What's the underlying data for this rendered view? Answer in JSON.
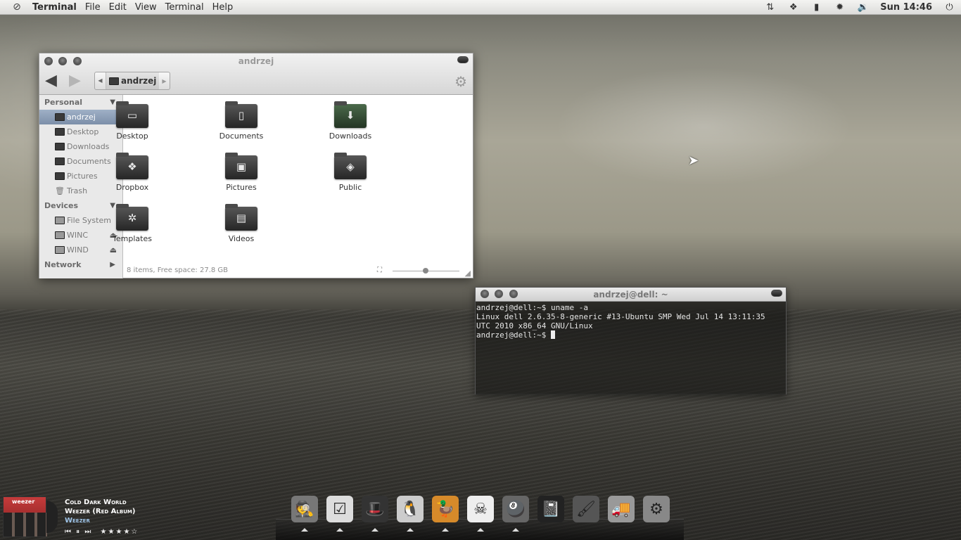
{
  "topbar": {
    "app_name": "Terminal",
    "menus": [
      "File",
      "Edit",
      "View",
      "Terminal",
      "Help"
    ],
    "tray_icons": [
      "network-icon",
      "dropbox-icon",
      "battery-icon",
      "weather-icon",
      "volume-icon"
    ],
    "clock": "Sun 14:46"
  },
  "file_manager": {
    "title": "andrzej",
    "breadcrumb": "andrzej",
    "sidebar": {
      "personal_label": "Personal",
      "personal_items": [
        "andrzej",
        "Desktop",
        "Downloads",
        "Documents",
        "Pictures",
        "Trash"
      ],
      "devices_label": "Devices",
      "device_items": [
        "File System",
        "WINC",
        "WIND"
      ],
      "network_label": "Network"
    },
    "files": [
      "Desktop",
      "Documents",
      "Downloads",
      "Dropbox",
      "Pictures",
      "Public",
      "Templates",
      "Videos"
    ],
    "status": "8 items, Free space: 27.8 GB"
  },
  "terminal": {
    "title": "andrzej@dell: ~",
    "lines": [
      "andrzej@dell:~$ uname -a",
      "Linux dell 2.6.35-8-generic #13-Ubuntu SMP Wed Jul 14 13:11:35",
      "UTC 2010 x86_64 GNU/Linux",
      "andrzej@dell:~$ "
    ]
  },
  "music": {
    "album_art_text": "weezer",
    "track": "Cold Dark World",
    "album": "Weezer (Red Album)",
    "artist": "Weezer",
    "controls": "⏮ ⏸ ⏭",
    "rating": "★★★★☆",
    "rating_value": 4
  },
  "dock": {
    "icons": [
      "spy-icon",
      "tasks-icon",
      "hat-icon",
      "penguin-bird-icon",
      "duck-icon",
      "mask-icon",
      "pool-icon",
      "notepad-icon",
      "brush-icon",
      "truck-icon",
      "system-settings-icon"
    ]
  }
}
